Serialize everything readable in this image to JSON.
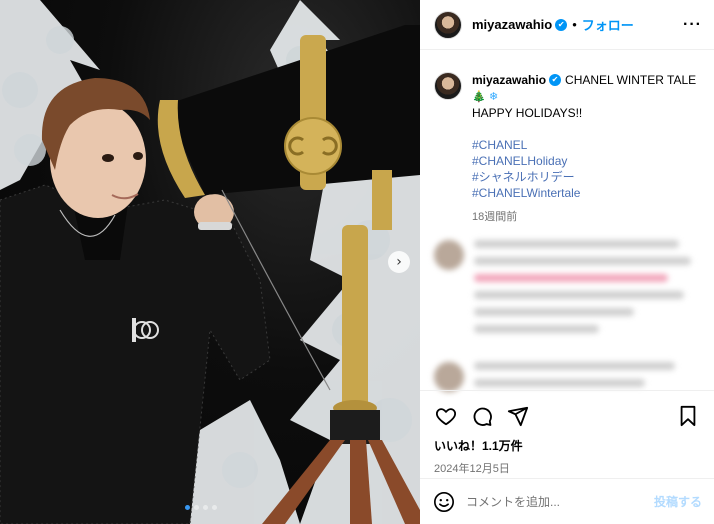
{
  "post": {
    "username": "miyazawahio",
    "follow_label": "フォロー",
    "separator": "•",
    "more_icon": "more-horizontal-icon",
    "verified_icon": "✔"
  },
  "caption": {
    "username": "miyazawahio",
    "title": "CHANEL WINTER TALE",
    "emoji_tree": "🎄",
    "emoji_snow": "❄",
    "line2": "HAPPY HOLIDAYS!!",
    "hashtags": [
      "#CHANEL",
      "#CHANELHoliday",
      "#シャネルホリデー",
      "#CHANELWintertale"
    ],
    "time": "18週間前"
  },
  "actions": {
    "icons": [
      "heart-icon",
      "comment-icon",
      "share-icon",
      "bookmark-icon"
    ],
    "likes": "いいね！1.1万件",
    "date": "2024年12月5日"
  },
  "comment_box": {
    "placeholder": "コメントを追加...",
    "post_label": "投稿する",
    "emoji_icon": "emoji-icon"
  },
  "carousel": {
    "next_icon": "›",
    "slide_count": 4,
    "active_slide": 1
  },
  "colors": {
    "link_blue": "#0095f6",
    "hashtag_blue": "#4a70b5",
    "muted_gray": "#737373"
  }
}
